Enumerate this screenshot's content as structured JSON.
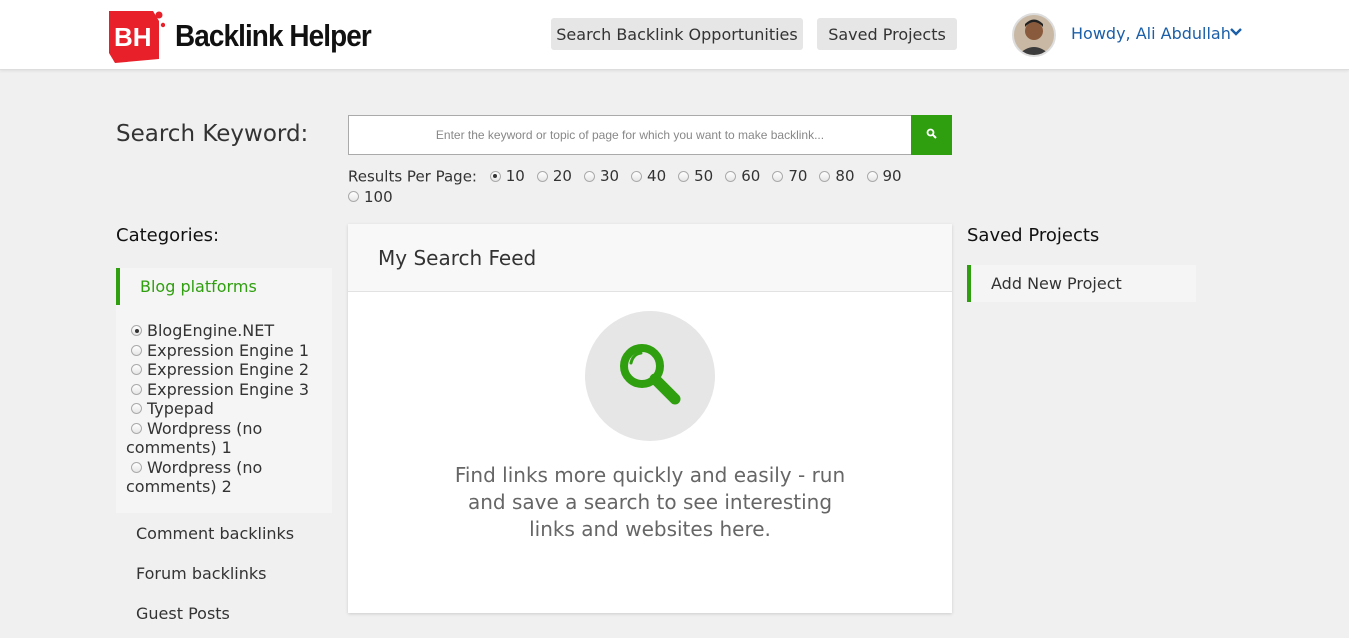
{
  "header": {
    "logo_text": "Backlink Helper",
    "logo_badge": "BH",
    "nav": {
      "search_label": "Search Backlink Opportunities",
      "saved_label": "Saved Projects"
    },
    "user_greeting": "Howdy, Ali Abdullah"
  },
  "search": {
    "label": "Search Keyword:",
    "placeholder": "Enter the keyword or topic of page for which you want to make backlink...",
    "results_label": "Results Per Page:",
    "results_options": [
      "10",
      "20",
      "30",
      "40",
      "50",
      "60",
      "70",
      "80",
      "90",
      "100"
    ],
    "results_selected": "10"
  },
  "categories": {
    "title": "Categories:",
    "active": "Blog platforms",
    "sub_items": [
      {
        "label": "BlogEngine.NET",
        "checked": true
      },
      {
        "label": "Expression Engine 1",
        "checked": false
      },
      {
        "label": "Expression Engine 2",
        "checked": false
      },
      {
        "label": "Expression Engine 3",
        "checked": false
      },
      {
        "label": "Typepad",
        "checked": false
      },
      {
        "label": "Wordpress (no comments) 1",
        "checked": false
      },
      {
        "label": "Wordpress (no comments) 2",
        "checked": false
      }
    ],
    "links": [
      "Comment backlinks",
      "Forum backlinks",
      "Guest Posts"
    ]
  },
  "feed": {
    "title": "My Search Feed",
    "message": "Find links more quickly and easily - run and save a search to see interesting links and websites here."
  },
  "saved_projects": {
    "title": "Saved Projects",
    "add_label": "Add New Project"
  },
  "colors": {
    "accent_green": "#2f9f0f",
    "brand_red": "#e8202a",
    "link_blue": "#1a5fa8"
  },
  "icons": {
    "search_button": "search-icon",
    "feed": "magnifier-icon",
    "user_menu": "chevron-down-icon"
  }
}
